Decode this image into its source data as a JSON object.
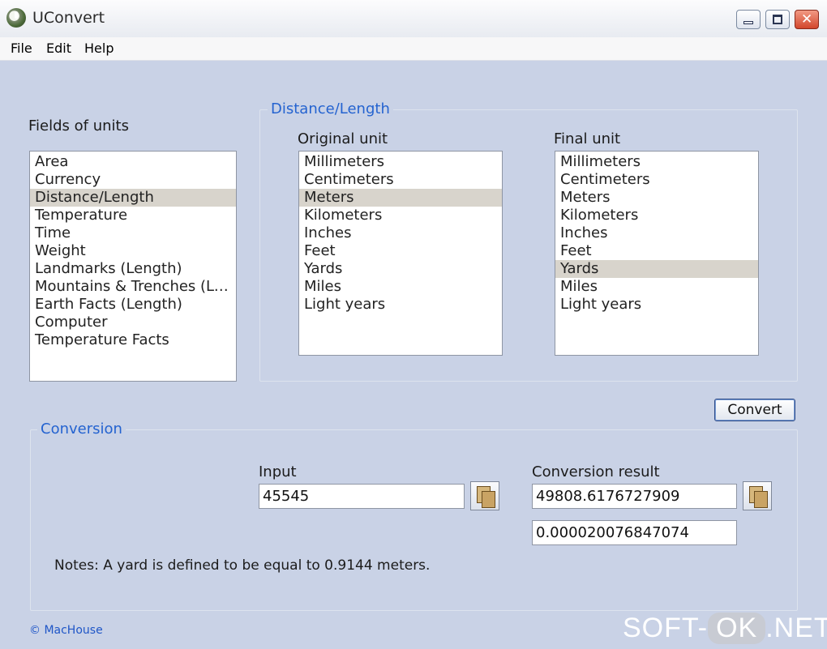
{
  "window": {
    "title": "UConvert"
  },
  "menu": [
    "File",
    "Edit",
    "Help"
  ],
  "fields": {
    "label": "Fields of units",
    "items": [
      "Area",
      "Currency",
      "Distance/Length",
      "Temperature",
      "Time",
      "Weight",
      "Landmarks (Length)",
      "Mountains & Trenches (Le…",
      "Earth Facts (Length)",
      "Computer",
      "Temperature Facts"
    ],
    "selected_index": 2
  },
  "distance_group": {
    "title": "Distance/Length",
    "original_label": "Original unit",
    "original_items": [
      "Millimeters",
      "Centimeters",
      "Meters",
      "Kilometers",
      "Inches",
      "Feet",
      "Yards",
      "Miles",
      "Light years"
    ],
    "original_selected_index": 2,
    "final_label": "Final unit",
    "final_items": [
      "Millimeters",
      "Centimeters",
      "Meters",
      "Kilometers",
      "Inches",
      "Feet",
      "Yards",
      "Miles",
      "Light years"
    ],
    "final_selected_index": 6
  },
  "convert_button": "Convert",
  "conversion": {
    "title": "Conversion",
    "input_label": "Input",
    "input_value": "45545",
    "result_label": "Conversion result",
    "result_value": "49808.6176727909",
    "result_secondary": "0.000020076847074",
    "notes": "Notes: A yard is defined to be equal to 0.9144 meters."
  },
  "footer": {
    "copyright": "© MacHouse"
  },
  "watermark": {
    "left": "SOFT-",
    "middle": "OK",
    "right": ".NET"
  }
}
